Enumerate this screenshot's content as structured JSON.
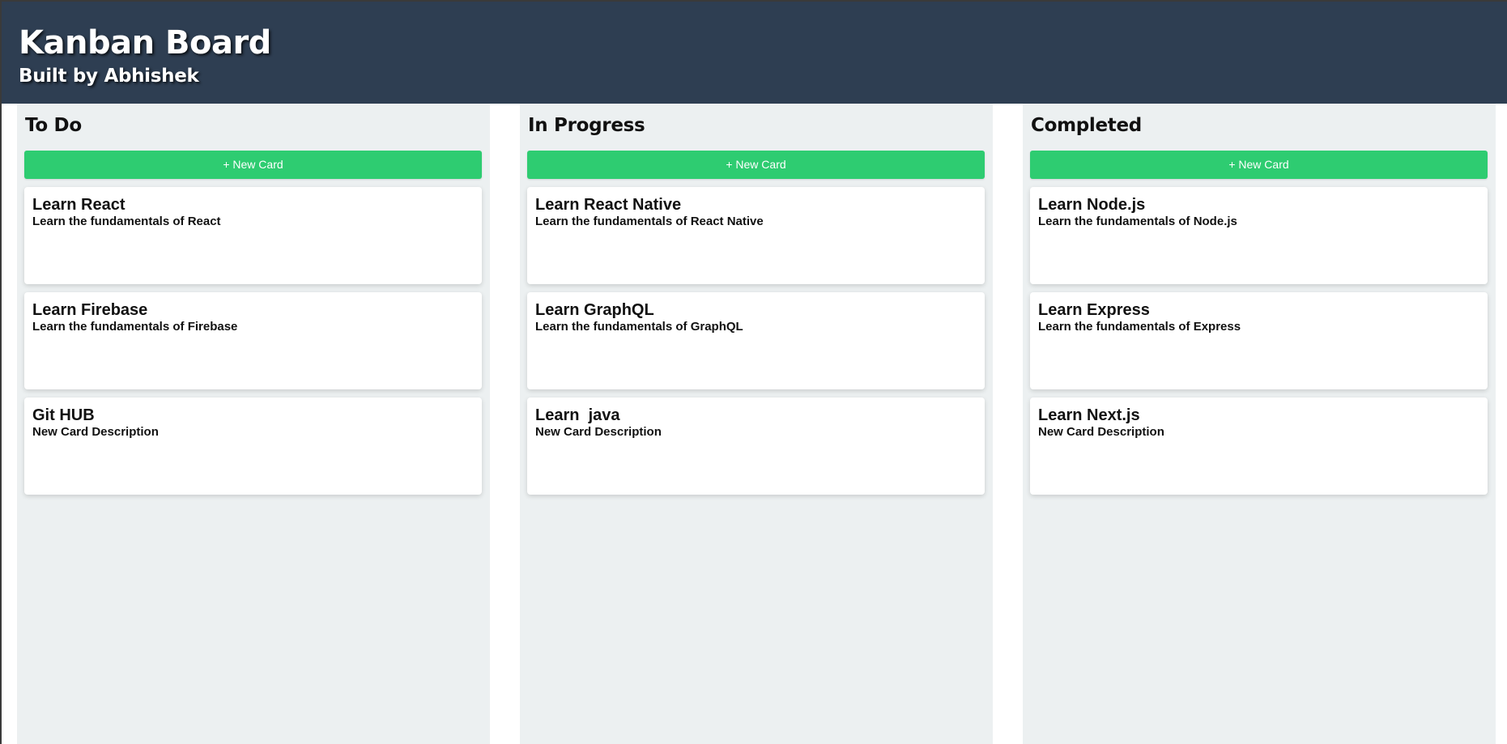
{
  "header": {
    "title": "Kanban Board",
    "subtitle": "Built by Abhishek"
  },
  "colors": {
    "header_bg": "#2e3e52",
    "column_bg": "#ecf0f1",
    "button_bg": "#2ecc71",
    "card_bg": "#ffffff"
  },
  "columns": [
    {
      "title": "To Do",
      "new_card_label": "+ New Card",
      "cards": [
        {
          "title": "Learn React",
          "description": "Learn the fundamentals of React"
        },
        {
          "title": "Learn Firebase",
          "description": "Learn the fundamentals of Firebase"
        },
        {
          "title": "Git HUB",
          "description": "New Card Description"
        }
      ]
    },
    {
      "title": "In Progress",
      "new_card_label": "+ New Card",
      "cards": [
        {
          "title": "Learn React Native",
          "description": "Learn the fundamentals of React Native"
        },
        {
          "title": "Learn GraphQL",
          "description": "Learn the fundamentals of GraphQL"
        },
        {
          "title": "Learn  java",
          "description": "New Card Description"
        }
      ]
    },
    {
      "title": "Completed",
      "new_card_label": "+ New Card",
      "cards": [
        {
          "title": "Learn Node.js",
          "description": "Learn the fundamentals of Node.js"
        },
        {
          "title": "Learn Express",
          "description": "Learn the fundamentals of Express"
        },
        {
          "title": "Learn Next.js",
          "description": "New Card Description"
        }
      ]
    }
  ]
}
